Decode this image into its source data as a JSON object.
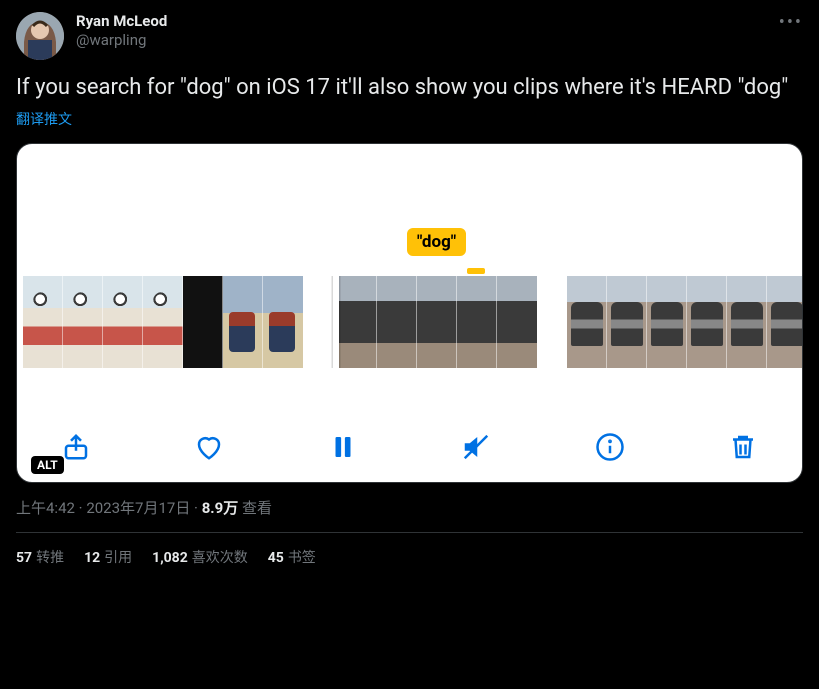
{
  "user": {
    "display_name": "Ryan McLeod",
    "handle": "@warpling"
  },
  "tweet": {
    "text": "If you search for \"dog\" on iOS 17 it'll also show you clips where it's HEARD \"dog\"",
    "translate_label": "翻译推文"
  },
  "media": {
    "keyword_label": "\"dog\"",
    "alt_badge": "ALT"
  },
  "meta": {
    "time": "上午4:42",
    "date": "2023年7月17日",
    "views_count": "8.9万",
    "views_label": "查看"
  },
  "stats": {
    "retweets_n": "57",
    "retweets_label": "转推",
    "quotes_n": "12",
    "quotes_label": "引用",
    "likes_n": "1,082",
    "likes_label": "喜欢次数",
    "bookmarks_n": "45",
    "bookmarks_label": "书签"
  }
}
